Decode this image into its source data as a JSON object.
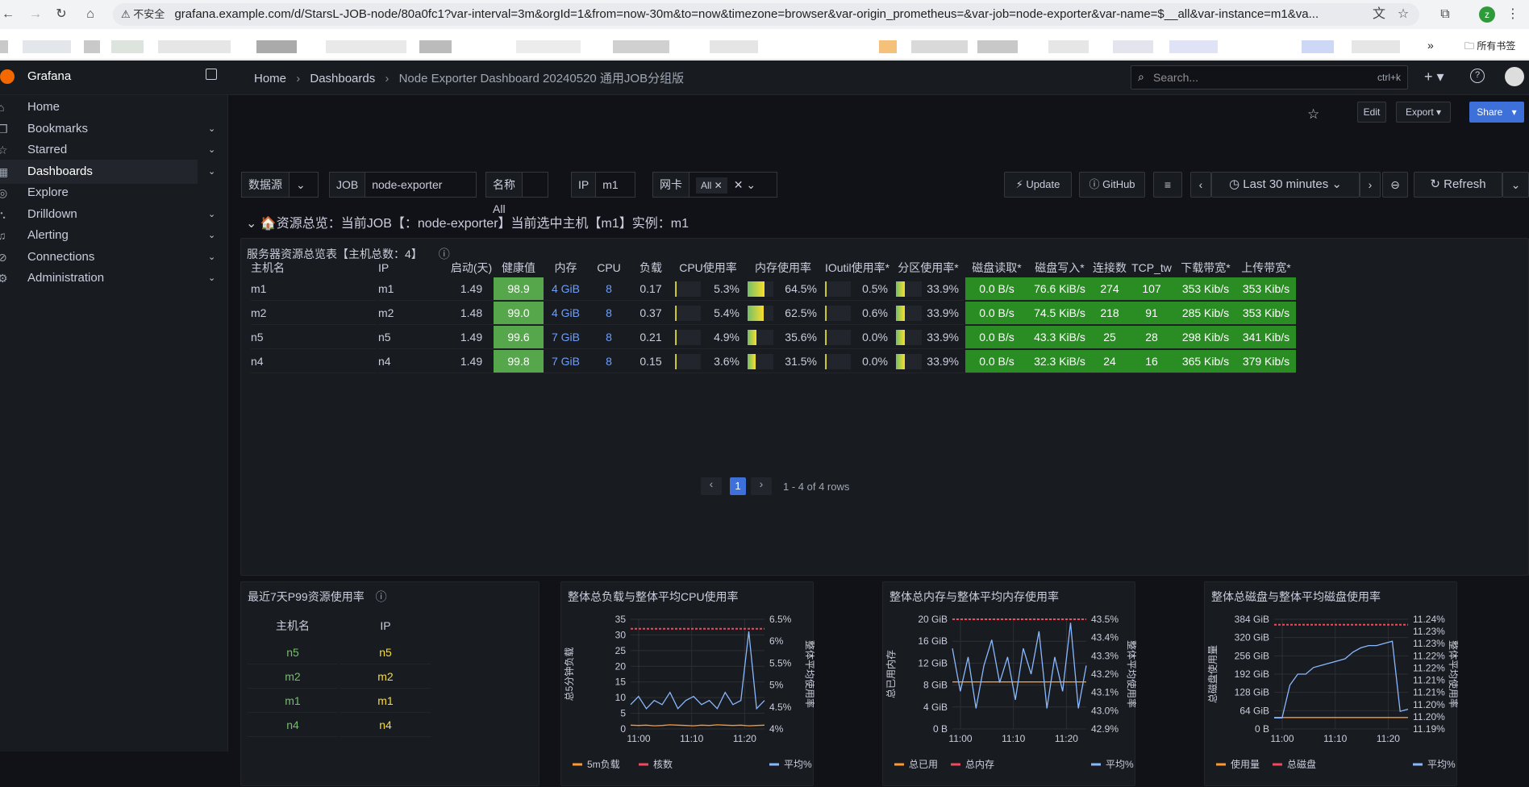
{
  "browser": {
    "security": "不安全",
    "url": "grafana.example.com/d/StarsL-JOB-node/80a0fc1?var-interval=3m&orgId=1&from=now-30m&to=now&timezone=browser&var-origin_prometheus=&var-job=node-exporter&var-name=$__all&var-instance=m1&va...",
    "bookmarks_folder": "所有书签",
    "profile_initial": "z"
  },
  "app": {
    "name": "Grafana"
  },
  "breadcrumb": {
    "home": "Home",
    "dashboards": "Dashboards",
    "current": "Node Exporter Dashboard 20240520 通用JOB分组版"
  },
  "search": {
    "placeholder": "Search...",
    "shortcut": "ctrl+k"
  },
  "toolbar": {
    "edit": "Edit",
    "export": "Export",
    "share": "Share"
  },
  "sidebar": {
    "items": [
      {
        "label": "Home"
      },
      {
        "label": "Bookmarks"
      },
      {
        "label": "Starred"
      },
      {
        "label": "Dashboards"
      },
      {
        "label": "Explore"
      },
      {
        "label": "Drilldown"
      },
      {
        "label": "Alerting"
      },
      {
        "label": "Connections"
      },
      {
        "label": "Administration"
      }
    ]
  },
  "variables": {
    "datasource_label": "数据源",
    "job_label": "JOB",
    "job_value": "node-exporter",
    "name_label": "名称",
    "name_value": "All",
    "ip_label": "IP",
    "ip_value": "m1",
    "nic_label": "网卡",
    "nic_value": "All"
  },
  "controls": {
    "update": "Update",
    "github": "GitHub",
    "timerange": "Last 30 minutes",
    "refresh": "Refresh"
  },
  "row": {
    "title": "资源总览：当前JOB【：node-exporter】当前选中主机【m1】实例：m1"
  },
  "table_panel": {
    "title": "服务器资源总览表【主机总数：4】",
    "headers": [
      "主机名",
      "IP",
      "启动(天)",
      "健康值",
      "内存",
      "CPU",
      "负载",
      "CPU使用率",
      "内存使用率",
      "IOutil使用率*",
      "分区使用率*",
      "磁盘读取*",
      "磁盘写入*",
      "连接数",
      "TCP_tw",
      "下载带宽*",
      "上传带宽*"
    ],
    "rows": [
      [
        "m1",
        "m1",
        "1.49",
        "98.9",
        "4 GiB",
        "8",
        "0.17",
        "5.3%",
        "64.5%",
        "0.5%",
        "33.9%",
        "0.0 B/s",
        "76.6 KiB/s",
        "274",
        "107",
        "353 Kib/s",
        "353 Kib/s"
      ],
      [
        "m2",
        "m2",
        "1.48",
        "99.0",
        "4 GiB",
        "8",
        "0.37",
        "5.4%",
        "62.5%",
        "0.6%",
        "33.9%",
        "0.0 B/s",
        "74.5 KiB/s",
        "218",
        "91",
        "285 Kib/s",
        "353 Kib/s"
      ],
      [
        "n5",
        "n5",
        "1.49",
        "99.6",
        "7 GiB",
        "8",
        "0.21",
        "4.9%",
        "35.6%",
        "0.0%",
        "33.9%",
        "0.0 B/s",
        "43.3 KiB/s",
        "25",
        "28",
        "298 Kib/s",
        "341 Kib/s"
      ],
      [
        "n4",
        "n4",
        "1.49",
        "99.8",
        "7 GiB",
        "8",
        "0.15",
        "3.6%",
        "31.5%",
        "0.0%",
        "33.9%",
        "0.0 B/s",
        "32.3 KiB/s",
        "24",
        "16",
        "365 Kib/s",
        "379 Kib/s"
      ]
    ],
    "pagination": {
      "page": "1",
      "summary": "1 - 4 of 4 rows"
    }
  },
  "p99_panel": {
    "title": "最近7天P99资源使用率",
    "headers": [
      "主机名",
      "IP"
    ],
    "rows": [
      [
        "n5",
        "n5"
      ],
      [
        "m2",
        "m2"
      ],
      [
        "m1",
        "m1"
      ],
      [
        "n4",
        "n4"
      ]
    ]
  },
  "chart_data": [
    {
      "type": "line",
      "title": "整体总负载与整体平均CPU使用率",
      "ylabel": "总5分钟负载",
      "y2label": "整体平均使用率",
      "x_ticks": [
        "11:00",
        "11:10",
        "11:20"
      ],
      "y_ticks": [
        "0",
        "5",
        "10",
        "15",
        "20",
        "25",
        "30",
        "35"
      ],
      "y2_ticks": [
        "4%",
        "4.5%",
        "5%",
        "5.5%",
        "6%",
        "6.5%"
      ],
      "ylim": [
        0,
        35
      ],
      "y2lim": [
        3.9,
        6.6
      ],
      "series": [
        {
          "name": "5m负载",
          "color": "#ff9830",
          "axis": "left",
          "values": [
            1.2,
            1.1,
            1.2,
            1.0,
            1.1,
            1.3,
            1.2,
            1.1,
            1.0,
            1.2,
            1.1,
            1.3,
            1.2,
            1.1,
            1.2,
            1.0,
            1.1,
            1.2
          ]
        },
        {
          "name": "核数",
          "color": "#f2495c",
          "axis": "left",
          "values": [
            32,
            32,
            32,
            32,
            32,
            32,
            32,
            32,
            32,
            32,
            32,
            32,
            32,
            32,
            32,
            32,
            32,
            32
          ]
        },
        {
          "name": "平均%",
          "color": "#8ab8ff",
          "axis": "right",
          "values": [
            4.5,
            4.7,
            4.4,
            4.6,
            4.5,
            4.8,
            4.4,
            4.6,
            4.7,
            4.5,
            4.6,
            4.4,
            4.8,
            4.5,
            4.6,
            6.3,
            4.4,
            4.6
          ]
        }
      ]
    },
    {
      "type": "line",
      "title": "整体总内存与整体平均内存使用率",
      "ylabel": "总已用内存",
      "y2label": "整体平均使用率",
      "x_ticks": [
        "11:00",
        "11:10",
        "11:20"
      ],
      "y_ticks": [
        "0 B",
        "4 GiB",
        "8 GiB",
        "12 GiB",
        "16 GiB",
        "20 GiB"
      ],
      "y2_ticks": [
        "42.9%",
        "43.0%",
        "43.1%",
        "43.2%",
        "43.3%",
        "43.4%",
        "43.5%"
      ],
      "ylim": [
        0,
        21
      ],
      "y2lim": [
        42.88,
        43.52
      ],
      "series": [
        {
          "name": "总已用",
          "color": "#ff9830",
          "axis": "left",
          "values": [
            9,
            9,
            9,
            9,
            9,
            9,
            9,
            9,
            9,
            9,
            9,
            9,
            9,
            9,
            9,
            9,
            9,
            9
          ]
        },
        {
          "name": "总内存",
          "color": "#f2495c",
          "axis": "left",
          "values": [
            22,
            22,
            22,
            22,
            22,
            22,
            22,
            22,
            22,
            22,
            22,
            22,
            22,
            22,
            22,
            22,
            22,
            22
          ]
        },
        {
          "name": "平均%",
          "color": "#8ab8ff",
          "axis": "right",
          "values": [
            43.35,
            43.1,
            43.3,
            43.0,
            43.25,
            43.4,
            43.15,
            43.3,
            43.05,
            43.35,
            43.2,
            43.45,
            43.0,
            43.3,
            43.1,
            43.5,
            43.0,
            43.25
          ]
        }
      ]
    },
    {
      "type": "line",
      "title": "整体总磁盘与整体平均磁盘使用率",
      "ylabel": "总磁盘使用量",
      "y2label": "整体平均使用率",
      "x_ticks": [
        "11:00",
        "11:10",
        "11:20"
      ],
      "y_ticks": [
        "0 B",
        "64 GiB",
        "128 GiB",
        "192 GiB",
        "256 GiB",
        "320 GiB",
        "384 GiB"
      ],
      "y2_ticks": [
        "11.19%",
        "11.20%",
        "11.20%",
        "11.21%",
        "11.21%",
        "11.22%",
        "11.22%",
        "11.23%",
        "11.23%",
        "11.24%"
      ],
      "ylim": [
        0,
        384
      ],
      "y2lim": [
        11.19,
        11.24
      ],
      "series": [
        {
          "name": "使用量",
          "color": "#ff9830",
          "axis": "left",
          "values": [
            40,
            40,
            40,
            40,
            40,
            40,
            40,
            40,
            40,
            40,
            40,
            40,
            40,
            40,
            40,
            40,
            40,
            40
          ]
        },
        {
          "name": "总磁盘",
          "color": "#f2495c",
          "axis": "left",
          "values": [
            365,
            365,
            365,
            365,
            365,
            365,
            365,
            365,
            365,
            365,
            365,
            365,
            365,
            365,
            365,
            365,
            365,
            365
          ]
        },
        {
          "name": "平均%",
          "color": "#8ab8ff",
          "axis": "right",
          "values": [
            11.195,
            11.195,
            11.21,
            11.215,
            11.215,
            11.218,
            11.219,
            11.22,
            11.221,
            11.222,
            11.225,
            11.227,
            11.228,
            11.228,
            11.229,
            11.23,
            11.198,
            11.199
          ]
        }
      ]
    }
  ]
}
